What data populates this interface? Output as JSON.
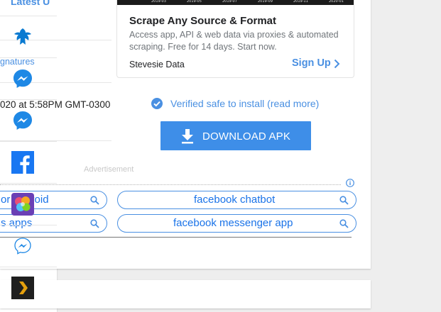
{
  "main": {
    "rows": [
      {
        "text": "gnatures",
        "color": "#4a90e2"
      },
      {
        "text": "020 at 5:58PM GMT-0300",
        "color": "#222222"
      }
    ],
    "ad": {
      "chart_ticks": [
        "2019-03",
        "2019-05",
        "2019-07",
        "2019-09",
        "2019-11",
        "2020-01"
      ],
      "title": "Scrape Any Source & Format",
      "description": "Access app, API & web data via proxies & automated scraping. Free for 14 days. Start now.",
      "advertiser": "Stevesie Data",
      "cta": "Sign Up"
    },
    "verified_text": "Verified safe to install (read more)",
    "download_label": "DOWNLOAD APK",
    "advertisement_label": "Advertisement",
    "search_pills": [
      {
        "label": "or android"
      },
      {
        "label": "facebook chatbot"
      },
      {
        "label": "s apps"
      },
      {
        "label": "facebook messenger app"
      }
    ]
  },
  "sidebar": {
    "title": "Latest U",
    "apps": [
      {
        "icon": "eagle-icon"
      },
      {
        "icon": "messenger-icon"
      },
      {
        "icon": "messenger-icon"
      },
      {
        "icon": "facebook-icon"
      },
      {
        "icon": "brain-puzzle-icon"
      },
      {
        "icon": "messenger-lite-icon"
      },
      {
        "icon": "plex-icon"
      }
    ]
  },
  "colors": {
    "accent": "#4a90e2",
    "button": "#3e8ee8",
    "background": "#eeeeee"
  }
}
